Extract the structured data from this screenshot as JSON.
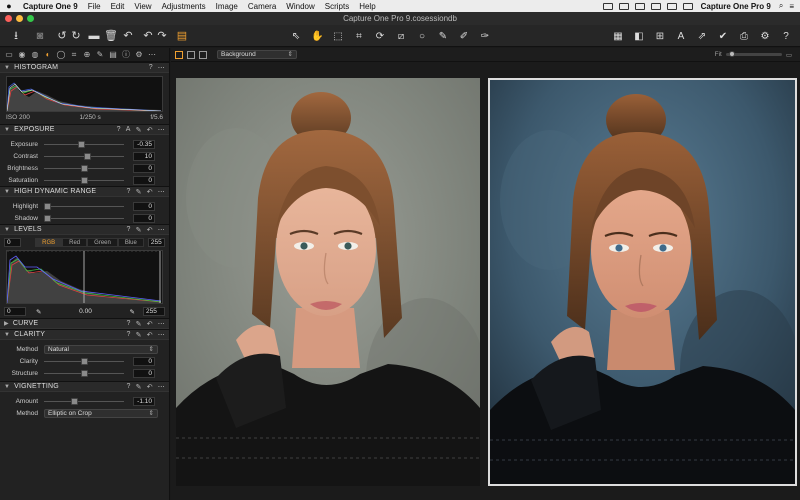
{
  "menubar": {
    "items": [
      "Capture One 9",
      "File",
      "Edit",
      "View",
      "Adjustments",
      "Image",
      "Camera",
      "Window",
      "Scripts",
      "Help"
    ],
    "app_right": "Capture One Pro 9"
  },
  "window": {
    "title": "Capture One Pro 9.cosessiondb"
  },
  "tool_tabs": [
    "library-tab",
    "capture-tab",
    "color-tab",
    "exposure-tab",
    "lens-tab",
    "composition-tab",
    "details-tab",
    "local-adjustments-tab",
    "adjustments-tab",
    "metadata-tab",
    "output-tab"
  ],
  "histogram": {
    "header": "HISTOGRAM",
    "iso": "ISO 200",
    "shutter": "1/250 s",
    "aperture": "f/5.6"
  },
  "exposure": {
    "header": "EXPOSURE",
    "sliders": [
      {
        "label": "Exposure",
        "value": "-0.35",
        "level": 0.46
      },
      {
        "label": "Contrast",
        "value": "10",
        "level": 0.55
      },
      {
        "label": "Brightness",
        "value": "0",
        "level": 0.5
      },
      {
        "label": "Saturation",
        "value": "0",
        "level": 0.5
      }
    ]
  },
  "hdr": {
    "header": "HIGH DYNAMIC RANGE",
    "sliders": [
      {
        "label": "Highlight",
        "value": "0",
        "level": 0.0
      },
      {
        "label": "Shadow",
        "value": "0",
        "level": 0.0
      }
    ]
  },
  "levels": {
    "header": "LEVELS",
    "low": "0",
    "high": "255",
    "tabs": [
      "RGB",
      "Red",
      "Green",
      "Blue"
    ],
    "out_low": "0",
    "mid": "0.00",
    "out_high": "255"
  },
  "curve": {
    "header": "CURVE"
  },
  "clarity": {
    "header": "CLARITY",
    "method_label": "Method",
    "method_value": "Natural",
    "sliders": [
      {
        "label": "Clarity",
        "value": "0",
        "level": 0.5
      },
      {
        "label": "Structure",
        "value": "0",
        "level": 0.5
      }
    ]
  },
  "vignetting": {
    "header": "VIGNETTING",
    "amount_label": "Amount",
    "amount_value": "-1.10",
    "amount_level": 0.37,
    "method_label": "Method",
    "method_value": "Elliptic on Crop"
  },
  "viewer": {
    "layer_select": "Background",
    "fit_label": "Fit"
  },
  "colors": {
    "accent": "#f0a030",
    "panel_bg": "#222222",
    "viewer_bg": "#1b1b1b"
  }
}
